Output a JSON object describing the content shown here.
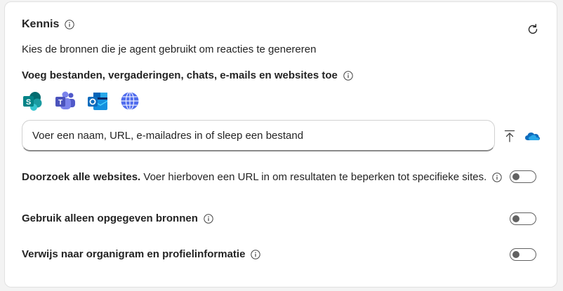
{
  "knowledge": {
    "title": "Kennis",
    "subtitle": "Kies de bronnen die je agent gebruikt om reacties te genereren"
  },
  "sources": {
    "title": "Voeg bestanden, vergaderingen, chats, e-mails en websites toe",
    "icons": [
      "sharepoint-icon",
      "teams-icon",
      "outlook-icon",
      "globe-icon"
    ],
    "search_placeholder": "Voer een naam, URL, e-mailadres in of sleep een bestand"
  },
  "options": {
    "search_web": {
      "bold": "Doorzoek alle websites.",
      "text": " Voer hierboven een URL in om resultaten te beperken tot specifieke sites.",
      "enabled": false
    },
    "only_specified": {
      "label": "Gebruik alleen opgegeven bronnen",
      "enabled": false
    },
    "org_chart": {
      "label": "Verwijs naar organigram en profielinformatie",
      "enabled": false
    }
  },
  "colors": {
    "sharepoint": "#038387",
    "teams": "#5b5fc7",
    "outlook": "#0f6cbd",
    "globe": "#4f6bed",
    "onedrive": "#0f6cbd"
  }
}
